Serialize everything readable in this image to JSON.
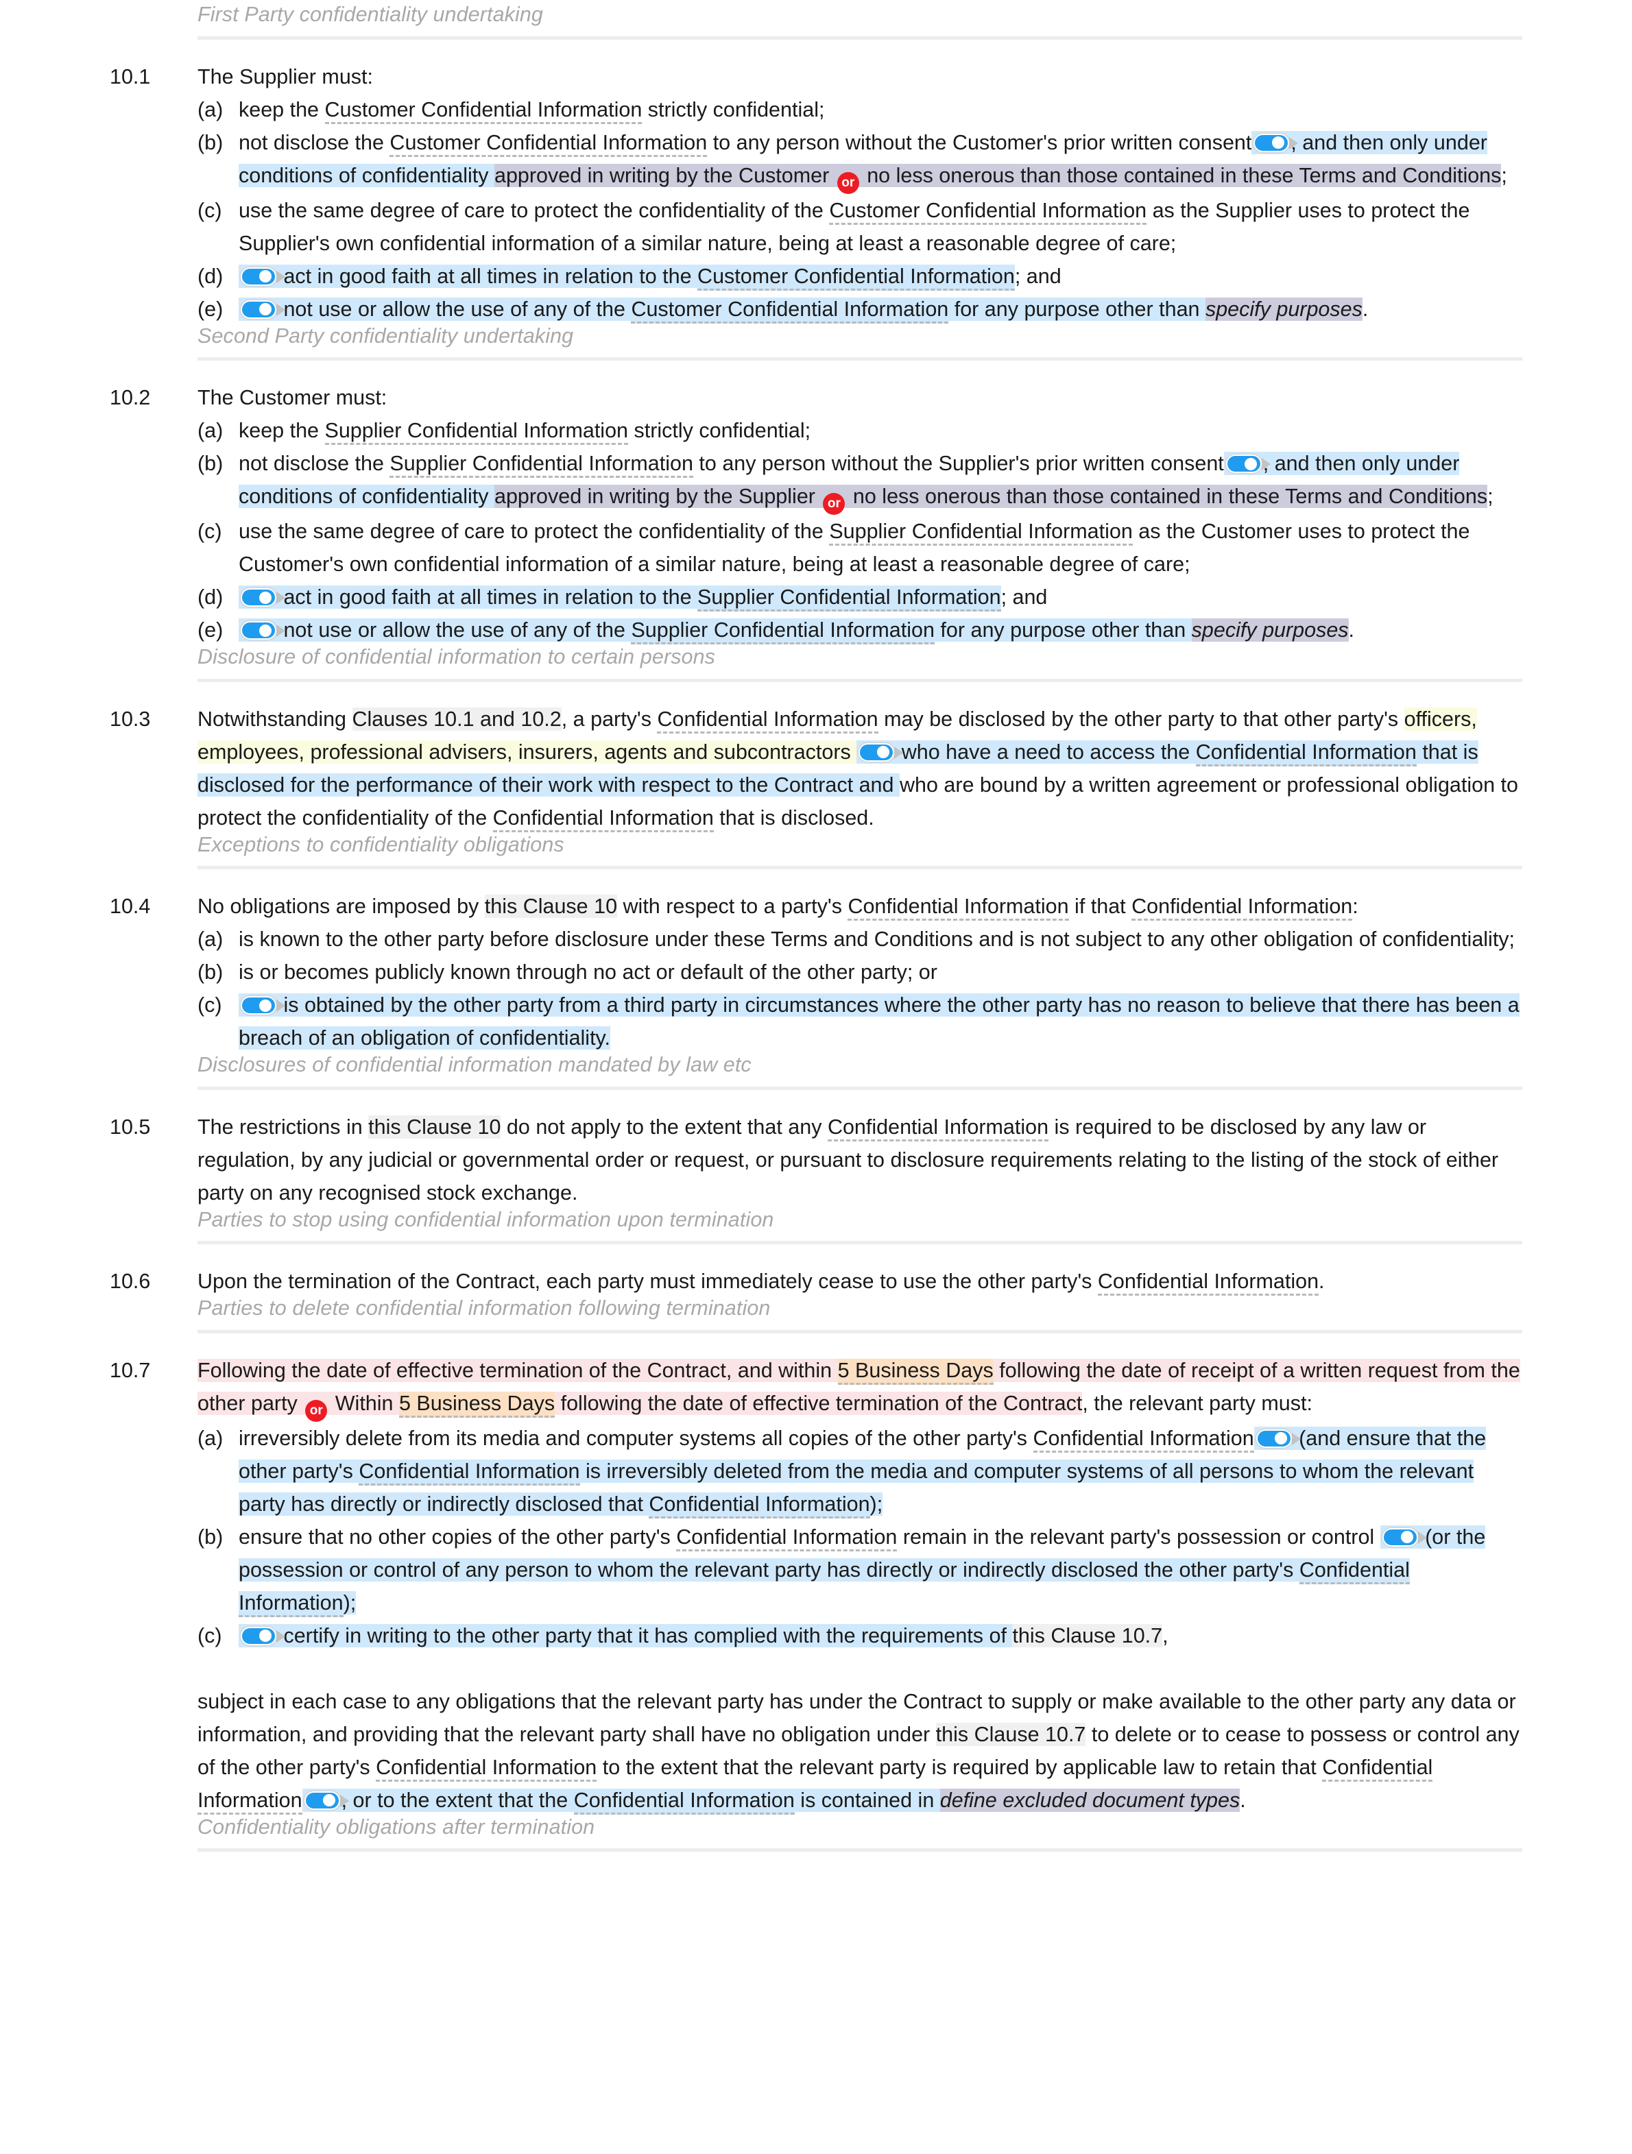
{
  "document": {
    "type": "contract-clause-page",
    "clause_group": "10"
  },
  "colors": {
    "highlight_blue": "#cfe8fb",
    "highlight_purple": "#ccccdd",
    "highlight_yellow": "#fbfbe0",
    "highlight_gray": "#f0f0f0",
    "highlight_pink": "#fbe4e6",
    "highlight_orange": "#fce0c4",
    "toggle_on": "#1f9cf0",
    "or_badge": "#ed1c24",
    "heading_text": "#a8a8a8",
    "rule": "#ededed"
  },
  "icons": {
    "toggle_on_label": "toggle-switch-on",
    "or_badge_label": "or"
  },
  "sections": [
    {
      "id": "first-party-confidentiality-undertaking",
      "heading": "First Party confidentiality undertaking",
      "clause": {
        "number": "10.1",
        "lead": "The Supplier must:",
        "items": [
          {
            "marker": "(a)",
            "segments": [
              {
                "text": "keep the "
              },
              {
                "text": "Customer Confidential Information",
                "dterm": true
              },
              {
                "text": " strictly confidential;"
              }
            ]
          },
          {
            "marker": "(b)",
            "segments": [
              {
                "text": "not disclose the "
              },
              {
                "text": "Customer Confidential Information",
                "dterm": true
              },
              {
                "text": " to any person without the Customer's prior written consent"
              },
              {
                "toggle": true,
                "hl": "blue"
              },
              {
                "text": ", and ",
                "hl": "blue"
              },
              {
                "text": "then only under conditions of confidentiality ",
                "hl": "blue"
              },
              {
                "text": "approved in writing by the Customer ",
                "hl": "purple"
              },
              {
                "orbadge": true,
                "hl": "purple"
              },
              {
                "text": " no less onerous than those contained in these Terms and Conditions",
                "hl": "purple"
              },
              {
                "text": ";"
              }
            ]
          },
          {
            "marker": "(c)",
            "segments": [
              {
                "text": "use the same degree of care to protect the confidentiality of the "
              },
              {
                "text": "Customer Confidential Information",
                "dterm": true
              },
              {
                "text": " as the Supplier uses to protect the Supplier's own confidential information of a similar nature, being at least a reasonable degree of care;"
              }
            ]
          },
          {
            "marker": "(d)",
            "segments": [
              {
                "toggle": true,
                "hl": "blue"
              },
              {
                "text": " act in good faith at all times in relation to the ",
                "hl": "blue"
              },
              {
                "text": "Customer Confidential Information",
                "hl": "blue",
                "dterm": true
              },
              {
                "text": "; and"
              }
            ]
          },
          {
            "marker": "(e)",
            "segments": [
              {
                "toggle": true,
                "hl": "blue"
              },
              {
                "text": " not use or allow the use of any of the ",
                "hl": "blue"
              },
              {
                "text": "Customer Confidential Information",
                "hl": "blue",
                "dterm": true
              },
              {
                "text": " for any purpose other than ",
                "hl": "blue"
              },
              {
                "text": "specify purposes",
                "hl": "purple",
                "italic": true
              },
              {
                "text": "."
              }
            ]
          }
        ]
      }
    },
    {
      "id": "second-party-confidentiality-undertaking",
      "heading": "Second Party confidentiality undertaking",
      "clause": {
        "number": "10.2",
        "lead": "The Customer must:",
        "items": [
          {
            "marker": "(a)",
            "segments": [
              {
                "text": "keep the "
              },
              {
                "text": "Supplier Confidential Information",
                "dterm": true
              },
              {
                "text": " strictly confidential;"
              }
            ]
          },
          {
            "marker": "(b)",
            "segments": [
              {
                "text": "not disclose the "
              },
              {
                "text": "Supplier Confidential Information",
                "dterm": true
              },
              {
                "text": " to any person without the Supplier's prior written consent"
              },
              {
                "toggle": true,
                "hl": "blue"
              },
              {
                "text": ", and ",
                "hl": "blue"
              },
              {
                "text": "then only under conditions of confidentiality ",
                "hl": "blue"
              },
              {
                "text": "approved in writing by the Supplier ",
                "hl": "purple"
              },
              {
                "orbadge": true,
                "hl": "purple"
              },
              {
                "text": " no less onerous than those contained in these Terms and Conditions",
                "hl": "purple"
              },
              {
                "text": ";"
              }
            ]
          },
          {
            "marker": "(c)",
            "segments": [
              {
                "text": "use the same degree of care to protect the confidentiality of the "
              },
              {
                "text": "Supplier Confidential Information",
                "dterm": true
              },
              {
                "text": " as the Customer uses to protect the Customer's own confidential information of a similar nature, being at least a reasonable degree of care;"
              }
            ]
          },
          {
            "marker": "(d)",
            "segments": [
              {
                "toggle": true,
                "hl": "blue"
              },
              {
                "text": " act in good faith at all times in relation to the ",
                "hl": "blue"
              },
              {
                "text": "Supplier Confidential Information",
                "hl": "blue",
                "dterm": true
              },
              {
                "text": "; and"
              }
            ]
          },
          {
            "marker": "(e)",
            "segments": [
              {
                "toggle": true,
                "hl": "blue"
              },
              {
                "text": " not use or allow the use of any of the ",
                "hl": "blue"
              },
              {
                "text": "Supplier Confidential Information",
                "hl": "blue",
                "dterm": true
              },
              {
                "text": " for any purpose other than ",
                "hl": "blue"
              },
              {
                "text": "specify purposes",
                "hl": "purple",
                "italic": true
              },
              {
                "text": "."
              }
            ]
          }
        ]
      }
    },
    {
      "id": "disclosure-of-confidential-information-to-certain-persons",
      "heading": "Disclosure of confidential information to certain persons",
      "clause": {
        "number": "10.3",
        "lead": null,
        "paragraph": [
          {
            "text": "Notwithstanding "
          },
          {
            "text": "Clauses 10.1 and 10.2",
            "hl": "gray"
          },
          {
            "text": ", a party's "
          },
          {
            "text": "Confidential Information",
            "dterm": true
          },
          {
            "text": " may be disclosed by the other party to that other party's "
          },
          {
            "text": "officers, employees, professional advisers, insurers, agents and subcontractors ",
            "hl": "yellow"
          },
          {
            "toggle": true,
            "hl": "blue"
          },
          {
            "text": " who have a need to access the ",
            "hl": "blue"
          },
          {
            "text": "Confidential Information",
            "hl": "blue",
            "dterm": true
          },
          {
            "text": " that is disclosed for the performance of their work with respect to the Contract and ",
            "hl": "blue"
          },
          {
            "text": "who are bound by a written agreement or professional obligation to protect the confidentiality of the "
          },
          {
            "text": "Confidential Information",
            "dterm": true
          },
          {
            "text": " that is disclosed."
          }
        ],
        "items": []
      }
    },
    {
      "id": "exceptions-to-confidentiality-obligations",
      "heading": "Exceptions to confidentiality obligations",
      "clause": {
        "number": "10.4",
        "lead_segments": [
          {
            "text": "No obligations are imposed by "
          },
          {
            "text": "this Clause 10",
            "hl": "gray"
          },
          {
            "text": " with respect to a party's "
          },
          {
            "text": "Confidential Information",
            "dterm": true
          },
          {
            "text": " if that "
          },
          {
            "text": "Confidential Information",
            "dterm": true
          },
          {
            "text": ":"
          }
        ],
        "items": [
          {
            "marker": "(a)",
            "segments": [
              {
                "text": "is known to the other party before disclosure under these Terms and Conditions and is not subject to any other obligation of confidentiality;"
              }
            ]
          },
          {
            "marker": "(b)",
            "segments": [
              {
                "text": "is or becomes publicly known through no act or default of the other party; or"
              }
            ]
          },
          {
            "marker": "(c)",
            "segments": [
              {
                "toggle": true,
                "hl": "blue"
              },
              {
                "text": " is obtained by the other party from a third party in circumstances where the other party has no reason to believe that there has been a breach of an obligation of confidentiality.",
                "hl": "blue"
              }
            ]
          }
        ]
      }
    },
    {
      "id": "disclosures-of-confidential-information-mandated-by-law-etc",
      "heading": "Disclosures of confidential information mandated by law etc",
      "clause": {
        "number": "10.5",
        "paragraph": [
          {
            "text": "The restrictions in "
          },
          {
            "text": "this Clause 10",
            "hl": "gray"
          },
          {
            "text": " do not apply to the extent that any "
          },
          {
            "text": "Confidential Information",
            "dterm": true
          },
          {
            "text": " is required to be disclosed by any law or regulation, by any judicial or governmental order or request, or pursuant to disclosure requirements relating to the listing of the stock of either party on any recognised stock exchange."
          }
        ],
        "items": []
      }
    },
    {
      "id": "parties-to-stop-using-confidential-information-upon-termination",
      "heading": "Parties to stop using confidential information upon termination",
      "clause": {
        "number": "10.6",
        "paragraph": [
          {
            "text": "Upon the termination of the Contract, each party must immediately cease to use the other party's "
          },
          {
            "text": "Confidential Information",
            "dterm": true
          },
          {
            "text": "."
          }
        ],
        "items": []
      }
    },
    {
      "id": "parties-to-delete-confidential-information-following-termination",
      "heading": "Parties to delete confidential information following termination",
      "clause": {
        "number": "10.7",
        "lead_segments": [
          {
            "text": "Following the date of effective termination of the Contract, and within ",
            "hl": "pink"
          },
          {
            "text": "5 Business Days",
            "hl": "orange",
            "dterm": true
          },
          {
            "text": " following the date of receipt of a written request from the other party ",
            "hl": "pink"
          },
          {
            "orbadge": true,
            "hl": "pink"
          },
          {
            "text": " Within ",
            "hl": "pink"
          },
          {
            "text": "5 Business Days",
            "hl": "orange",
            "dterm": true
          },
          {
            "text": " following the date of effective termination of the Contract",
            "hl": "pink"
          },
          {
            "text": ", the relevant party must:"
          }
        ],
        "items": [
          {
            "marker": "(a)",
            "segments": [
              {
                "text": "irreversibly delete from its media and computer systems all copies of the other party's "
              },
              {
                "text": "Confidential Information",
                "dterm": true
              },
              {
                "toggle": true,
                "hl": "blue"
              },
              {
                "text": " (and ensure that the other party's ",
                "hl": "blue"
              },
              {
                "text": "Confidential Information",
                "hl": "blue",
                "dterm": true
              },
              {
                "text": " is irreversibly deleted from the media and computer systems of all persons to whom the relevant party has directly or indirectly disclosed that ",
                "hl": "blue"
              },
              {
                "text": "Confidential Information",
                "hl": "blue",
                "dterm": true
              },
              {
                "text": ");",
                "hl": "blue"
              }
            ]
          },
          {
            "marker": "(b)",
            "segments": [
              {
                "text": "ensure that no other copies of the other party's "
              },
              {
                "text": "Confidential Information",
                "dterm": true
              },
              {
                "text": " remain in the relevant party's possession or control "
              },
              {
                "toggle": true,
                "hl": "blue"
              },
              {
                "text": " (or the possession or control of any person to whom the relevant party has directly or indirectly disclosed the other party's ",
                "hl": "blue"
              },
              {
                "text": "Confidential Information",
                "hl": "blue",
                "dterm": true
              },
              {
                "text": ");",
                "hl": "blue"
              }
            ]
          },
          {
            "marker": "(c)",
            "segments": [
              {
                "toggle": true,
                "hl": "blue"
              },
              {
                "text": " certify in writing to the other party that it has complied with the requirements of ",
                "hl": "blue"
              },
              {
                "text": "this Clause 10.7",
                "hl": "gray"
              },
              {
                "text": ","
              }
            ]
          }
        ],
        "trailing": [
          {
            "text": "subject in each case to any obligations that the relevant party has under the Contract to supply or make available to the other party any data or information, and providing that the relevant party shall have no obligation under "
          },
          {
            "text": "this Clause 10.7",
            "hl": "gray"
          },
          {
            "text": " to delete or to cease to possess or control any of the other party's "
          },
          {
            "text": "Confidential Information",
            "dterm": true
          },
          {
            "text": " to the extent that the relevant party is required by applicable law to retain that "
          },
          {
            "text": "Confidential Information",
            "dterm": true
          },
          {
            "toggle": true,
            "hl": "blue"
          },
          {
            "text": ", or to the extent that the ",
            "hl": "blue"
          },
          {
            "text": "Confidential Information",
            "hl": "blue",
            "dterm": true
          },
          {
            "text": " is contained in ",
            "hl": "blue"
          },
          {
            "text": "define excluded document types",
            "hl": "purple",
            "italic": true
          },
          {
            "text": "."
          }
        ]
      }
    },
    {
      "id": "confidentiality-obligations-after-termination",
      "heading": "Confidentiality obligations after termination",
      "clause": null
    }
  ]
}
